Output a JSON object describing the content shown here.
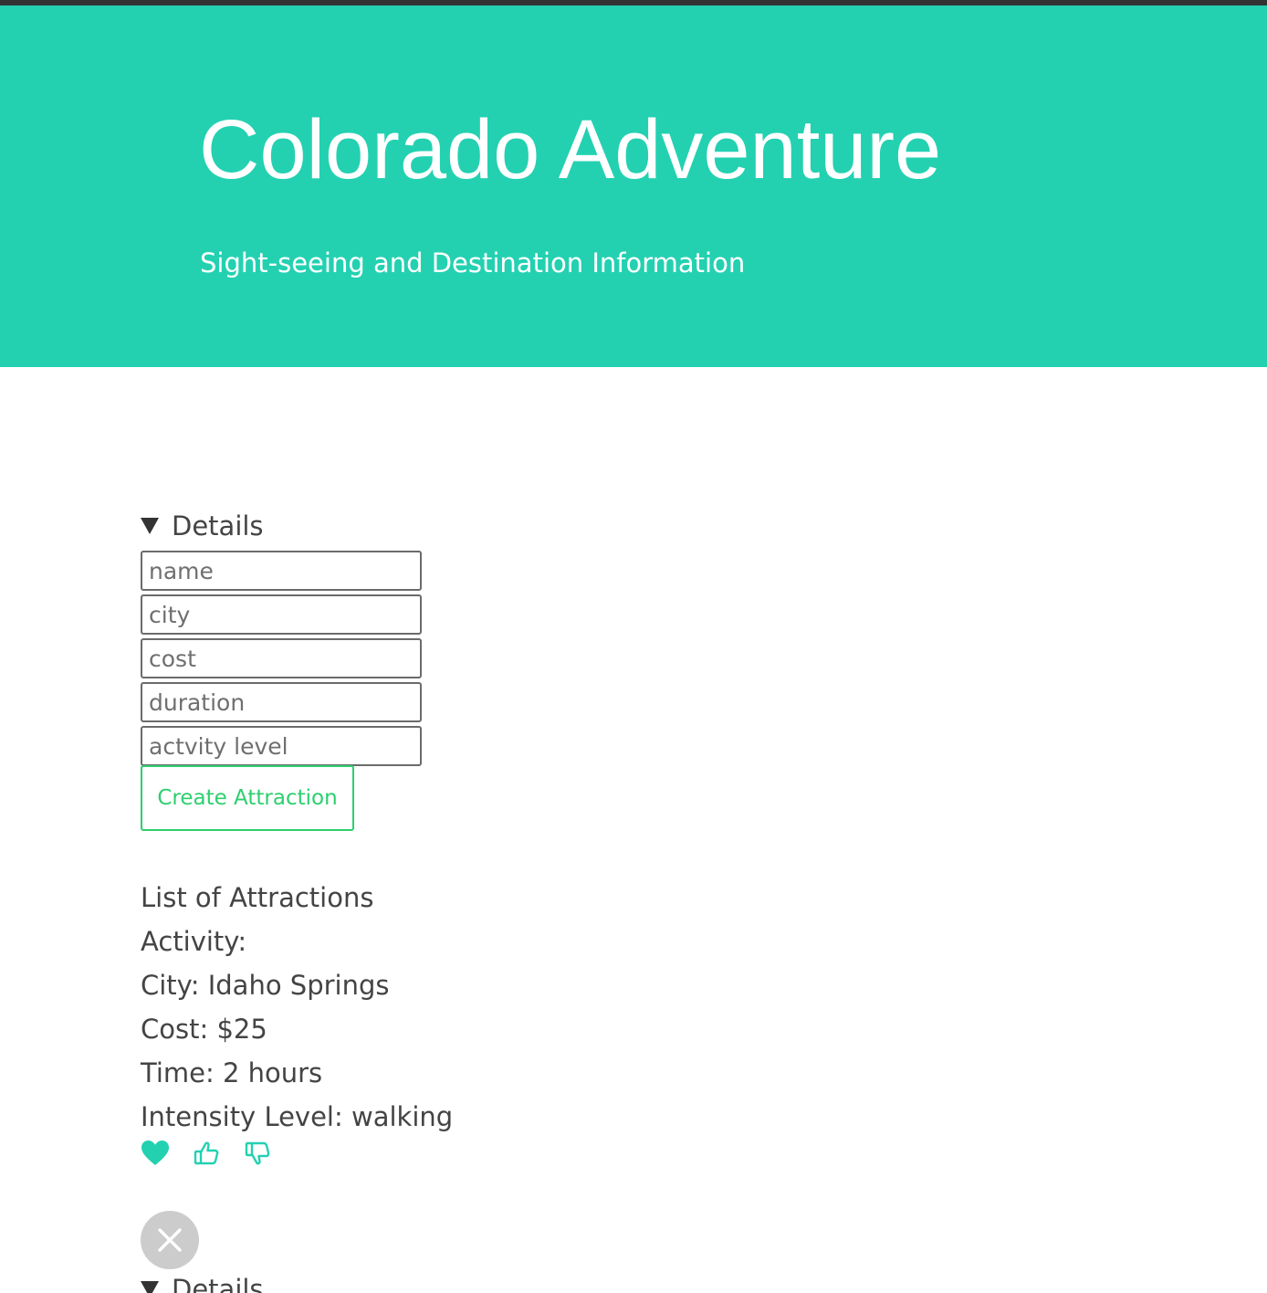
{
  "header": {
    "title": "Colorado Adventure",
    "subtitle": "Sight-seeing and Destination Information"
  },
  "form": {
    "summary_label": "Details",
    "fields": [
      {
        "placeholder": "name"
      },
      {
        "placeholder": "city"
      },
      {
        "placeholder": "cost"
      },
      {
        "placeholder": "duration"
      },
      {
        "placeholder": "actvity level"
      }
    ],
    "submit_label": "Create Attraction"
  },
  "list": {
    "heading": "List of Attractions",
    "item": {
      "activity": "Activity:",
      "city": "City: Idaho Springs",
      "cost": "Cost: $25",
      "time": "Time: 2 hours",
      "intensity": "Intensity Level: walking",
      "actions": [
        "heart-icon",
        "thumbs-up-icon",
        "thumbs-down-icon"
      ]
    },
    "next_summary_label": "Details"
  },
  "colors": {
    "accent": "#23d1b1",
    "button": "#2ccf6f",
    "close_button": "#cccccc"
  }
}
